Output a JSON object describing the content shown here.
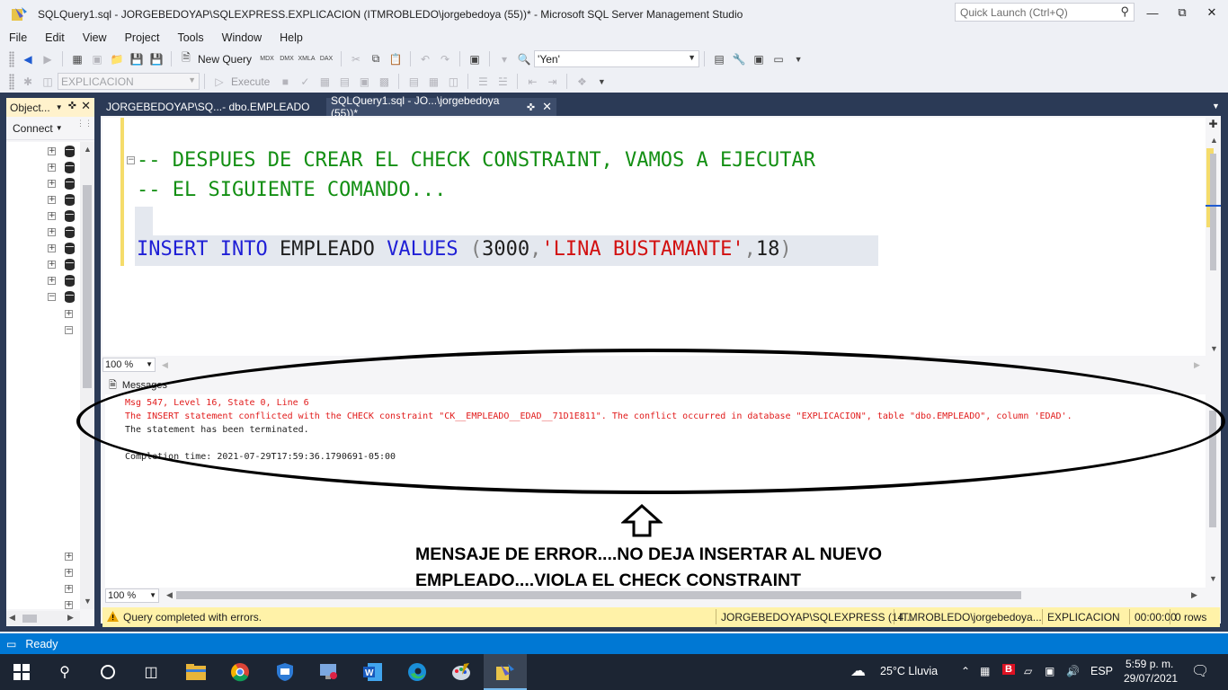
{
  "window": {
    "title": "SQLQuery1.sql - JORGEBEDOYAP\\SQLEXPRESS.EXPLICACION (ITMROBLEDO\\jorgebedoya (55))* - Microsoft SQL Server Management Studio",
    "quick_launch_placeholder": "Quick Launch (Ctrl+Q)"
  },
  "menu": [
    "File",
    "Edit",
    "View",
    "Project",
    "Tools",
    "Window",
    "Help"
  ],
  "toolbar": {
    "new_query_label": "New Query",
    "mdx": "MDX",
    "dmx": "DMX",
    "xmla": "XMLA",
    "dax": "DAX",
    "find_value": "'Yen'",
    "database_value": "EXPLICACION",
    "execute_label": "Execute"
  },
  "object_explorer": {
    "tab_label": "Object...",
    "connect_label": "Connect"
  },
  "tabs": [
    {
      "label": "JORGEBEDOYAP\\SQ...- dbo.EMPLEADO",
      "active": false
    },
    {
      "label": "SQLQuery1.sql - JO...\\jorgebedoya (55))*",
      "active": true
    }
  ],
  "editor": {
    "comment_line1": "-- DESPUES DE CREAR EL CHECK CONSTRAINT, VAMOS A EJECUTAR",
    "comment_line2": "-- EL SIGUIENTE COMANDO...",
    "sql": {
      "kw1": "INSERT",
      "kw2": "INTO",
      "table": "EMPLEADO",
      "kw3": "VALUES",
      "open": "(",
      "num1": "3000",
      "comma1": ",",
      "str": "'LINA BUSTAMANTE'",
      "comma2": ",",
      "num2": "18",
      "close": ")"
    },
    "zoom": "100 %"
  },
  "results": {
    "tab_label": "Messages",
    "lines": [
      "Msg 547, Level 16, State 0, Line 6",
      "The INSERT statement conflicted with the CHECK constraint \"CK__EMPLEADO__EDAD__71D1E811\". The conflict occurred in database \"EXPLICACION\", table \"dbo.EMPLEADO\", column 'EDAD'.",
      "The statement has been terminated.",
      "Completion time: 2021-07-29T17:59:36.1790691-05:00"
    ],
    "zoom": "100 %"
  },
  "annotation": {
    "line1": "MENSAJE DE ERROR....NO DEJA INSERTAR AL NUEVO",
    "line2": "EMPLEADO....VIOLA EL CHECK CONSTRAINT"
  },
  "query_status": {
    "message": "Query completed with errors.",
    "server": "JORGEBEDOYAP\\SQLEXPRESS (14...",
    "user": "ITMROBLEDO\\jorgebedoya...",
    "database": "EXPLICACION",
    "time": "00:00:00",
    "rows": "0 rows"
  },
  "status_bar": {
    "text": "Ready"
  },
  "taskbar": {
    "weather": "25°C  Lluvia",
    "lang": "ESP",
    "time": "5:59 p. m.",
    "date": "29/07/2021"
  },
  "colors": {
    "accent_blue": "#0078d4",
    "frame": "#2b3a56",
    "error_red": "#e11b1b",
    "comment_green": "#138f13",
    "keyword_blue": "#1f1fd6",
    "warning_yellow": "#fff2a8"
  }
}
